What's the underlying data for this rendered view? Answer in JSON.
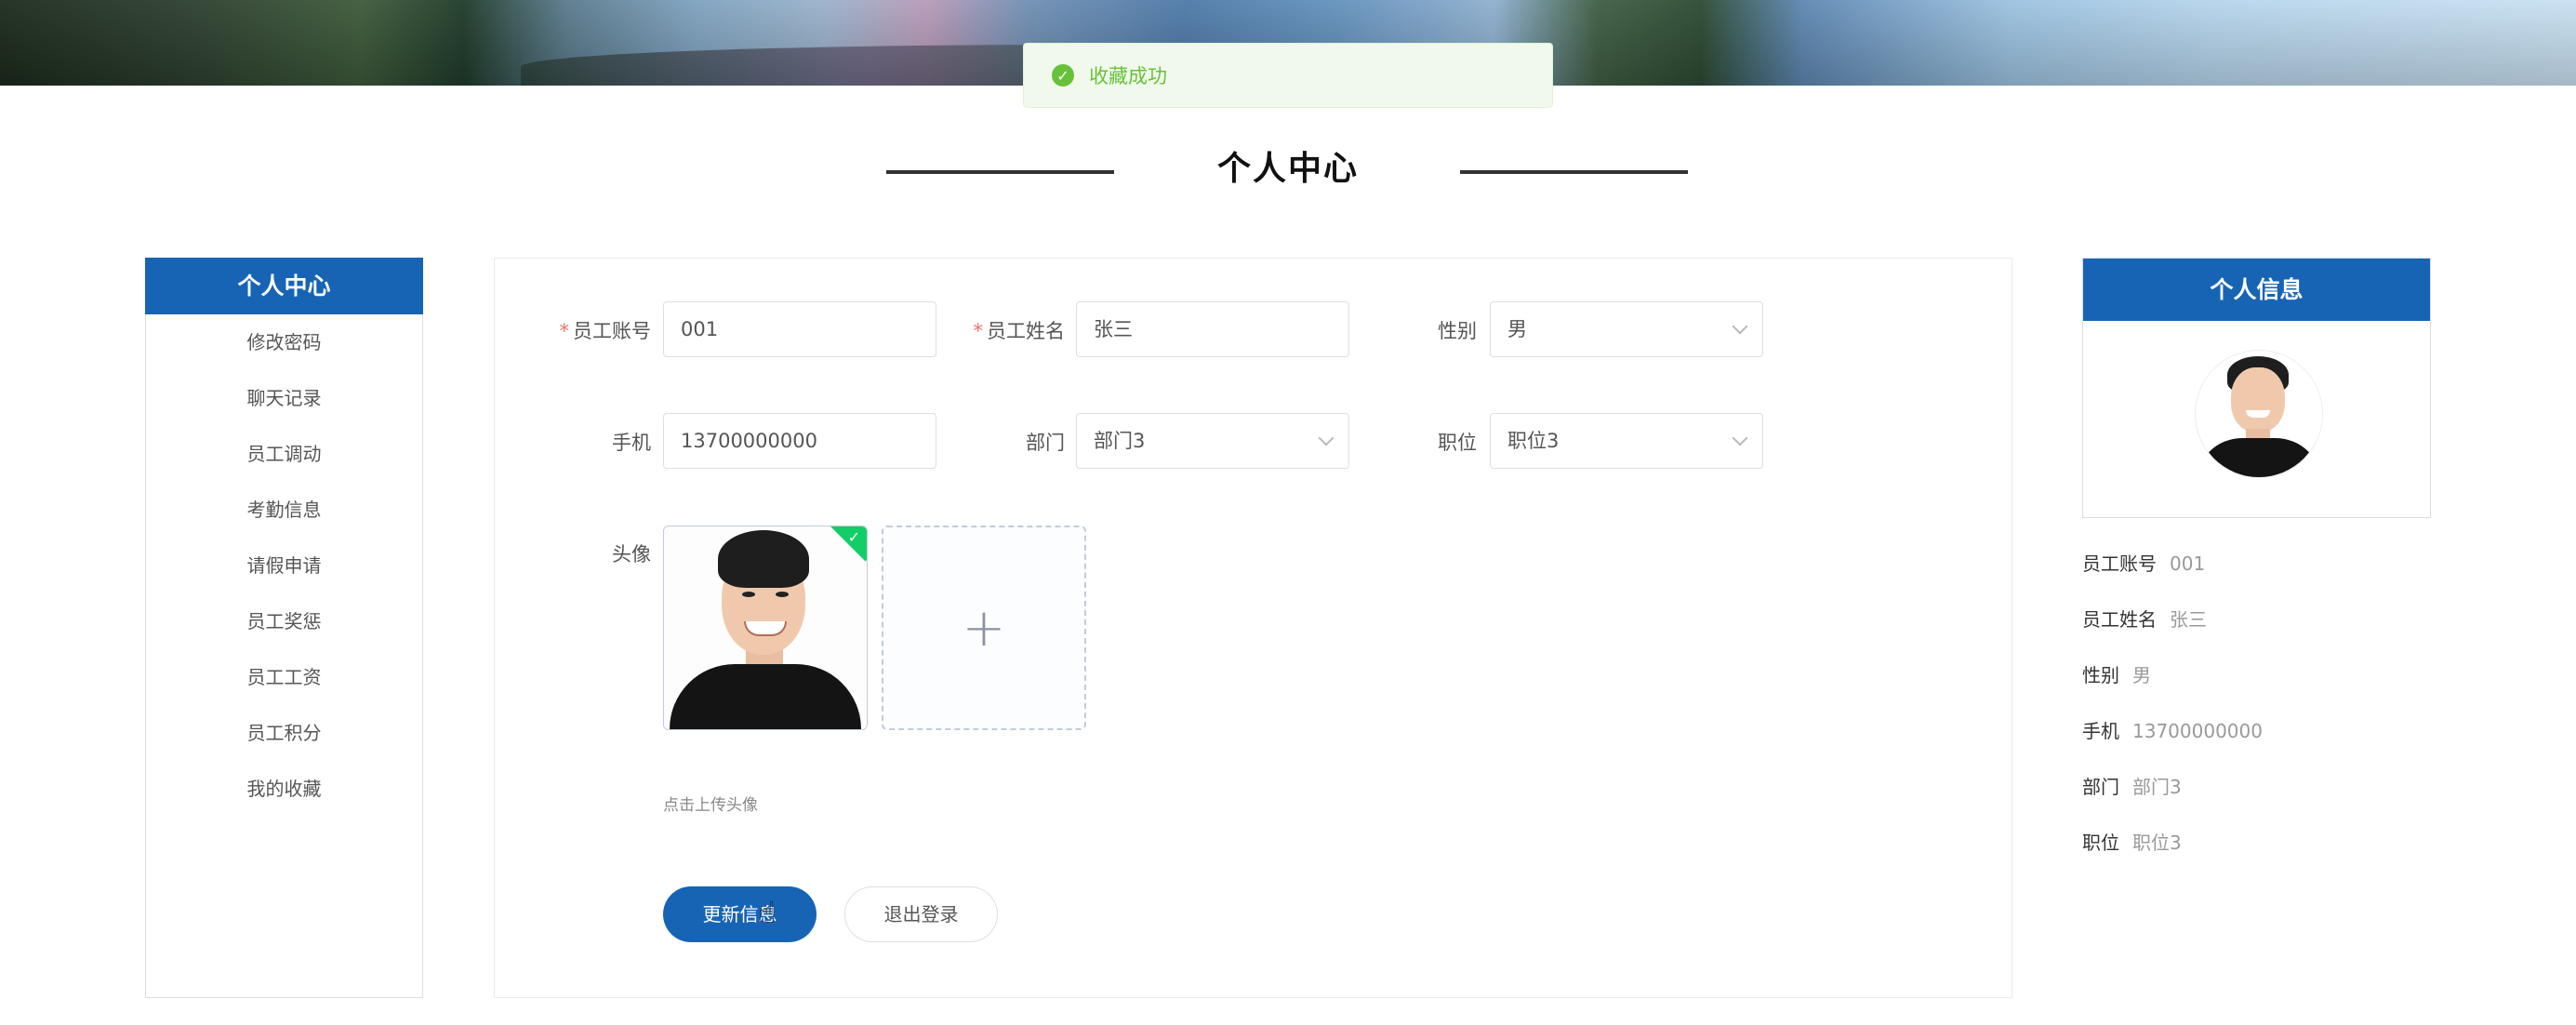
{
  "toast": {
    "message": "收藏成功",
    "icon": "check-circle-icon",
    "color": "#67c23a"
  },
  "page": {
    "title": "个人中心",
    "accent": "#1764b5"
  },
  "left_menu": {
    "heading": "个人中心",
    "items": [
      "修改密码",
      "聊天记录",
      "员工调动",
      "考勤信息",
      "请假申请",
      "员工奖惩",
      "员工工资",
      "员工积分",
      "我的收藏"
    ]
  },
  "form": {
    "account_label": "员工账号",
    "account_value": "001",
    "name_label": "员工姓名",
    "name_value": "张三",
    "gender_label": "性别",
    "gender_value": "男",
    "phone_label": "手机",
    "phone_value": "13700000000",
    "dept_label": "部门",
    "dept_value": "部门3",
    "position_label": "职位",
    "position_value": "职位3",
    "avatar_label": "头像",
    "upload_hint": "点击上传头像",
    "update_button": "更新信息",
    "logout_button": "退出登录"
  },
  "info_card": {
    "heading": "个人信息",
    "rows": [
      {
        "label": "员工账号",
        "value": "001"
      },
      {
        "label": "员工姓名",
        "value": "张三"
      },
      {
        "label": "性别",
        "value": "男"
      },
      {
        "label": "手机",
        "value": "13700000000"
      },
      {
        "label": "部门",
        "value": "部门3"
      },
      {
        "label": "职位",
        "value": "职位3"
      }
    ]
  }
}
